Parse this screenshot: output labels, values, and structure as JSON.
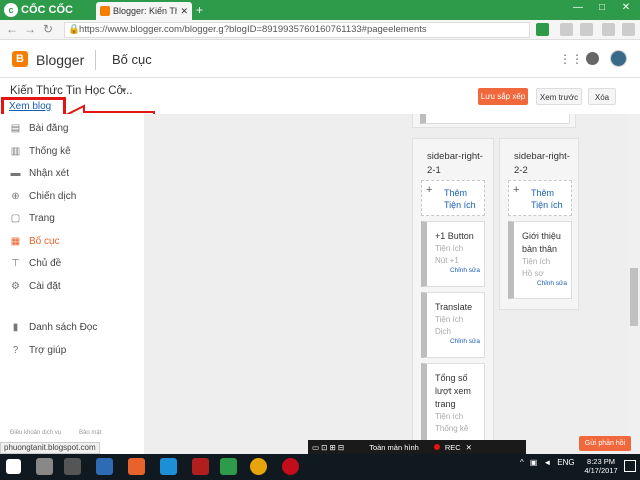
{
  "browser": {
    "brand": "CỐC CỐC",
    "tab_title": "Blogger: Kiến Thức Tin Họ",
    "new_tab": "+",
    "url": "https://www.blogger.com/blogger.g?blogID=8919935760160761133#pageelements",
    "window_buttons": [
      "—",
      "□",
      "✕"
    ]
  },
  "header": {
    "app_name": "Blogger",
    "section": "Bố cục"
  },
  "subheader": {
    "blog_name": "Kiến Thức Tin Học Cô...",
    "view_blog": "Xem blog",
    "save": "Lưu sắp xếp",
    "preview": "Xem trước",
    "clear": "Xóa"
  },
  "sidebar": {
    "items": [
      {
        "label": "Bài đăng",
        "icon": "posts-icon"
      },
      {
        "label": "Thống kê",
        "icon": "stats-icon"
      },
      {
        "label": "Nhận xét",
        "icon": "comments-icon"
      },
      {
        "label": "Chiến dịch",
        "icon": "campaign-icon"
      },
      {
        "label": "Trang",
        "icon": "pages-icon"
      },
      {
        "label": "Bố cục",
        "icon": "layout-icon",
        "active": true
      },
      {
        "label": "Chủ đề",
        "icon": "theme-icon"
      },
      {
        "label": "Cài đặt",
        "icon": "settings-icon"
      },
      {
        "label": "Danh sách Đọc",
        "icon": "reading-list-icon"
      },
      {
        "label": "Trợ giúp",
        "icon": "help-icon"
      }
    ],
    "footer": [
      "Điều khoản dịch vụ",
      "Bảo mật"
    ]
  },
  "status_url": "phuongtanit.blogspot.com",
  "layout": {
    "col1": {
      "title": "sidebar-right-2-1",
      "add_widget": "Thêm Tiện ích",
      "gadgets": [
        {
          "title": "+1 Button",
          "type": "Tiện ích",
          "name": "Nút +1",
          "edit": "Chỉnh sửa"
        },
        {
          "title": "Translate",
          "type": "Tiện ích",
          "name": "Dịch",
          "edit": "Chỉnh sửa"
        },
        {
          "title": "Tổng số lượt xem trang",
          "type": "Tiện ích",
          "name": "Thống kê",
          "edit": ""
        }
      ]
    },
    "col2": {
      "title": "sidebar-right-2-2",
      "add_widget": "Thêm Tiện ích",
      "gadgets": [
        {
          "title": "Giới thiệu bản thân",
          "type": "Tiện ích",
          "name": "Hồ sơ",
          "edit": "Chỉnh sửa"
        }
      ]
    }
  },
  "recorder": {
    "label": "Toàn màn hình",
    "rec": "REC"
  },
  "feedback": "Gửi phản hồi",
  "taskbar": {
    "lang": "ENG",
    "time": "8:23 PM",
    "date": "4/17/2017"
  },
  "colors": {
    "accent": "#f0683c",
    "browser_green": "#2e9b4a",
    "highlight_red": "#e31515"
  }
}
